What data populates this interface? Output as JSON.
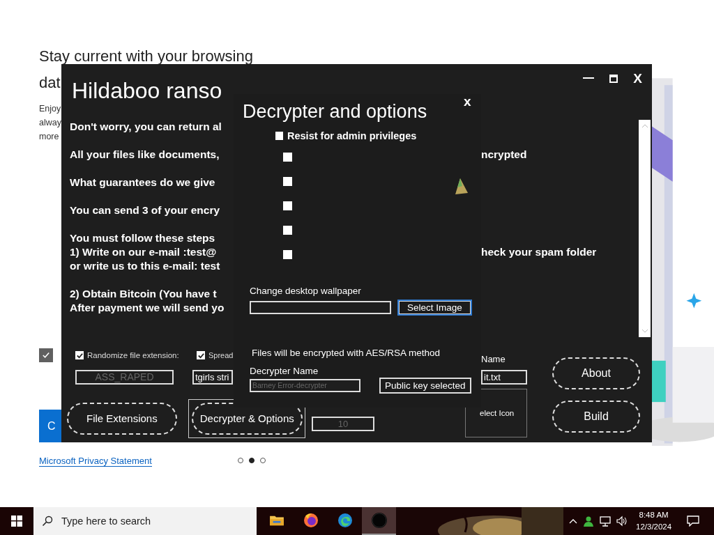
{
  "browser_page": {
    "heading_lines": [
      "Stay current with your browsing",
      "dat"
    ],
    "body_lines": [
      "Enjoy",
      "alway",
      "more"
    ],
    "checkbox": {
      "checked": true
    },
    "primary_button": {
      "label": "C"
    },
    "privacy_link": "Microsoft Privacy Statement",
    "carousel_dots": [
      {
        "selected": false
      },
      {
        "selected": true
      },
      {
        "selected": false
      }
    ]
  },
  "builder_window": {
    "title": "Hildaboo ranso",
    "close": "X",
    "message": [
      [
        {
          "text": "Don't worry, you can return al"
        }
      ],
      [
        {
          "text": "All your files like documents, ",
          "tail": "ncrypted"
        }
      ],
      [
        {
          "text": "What guarantees do we give "
        }
      ],
      [
        {
          "text": "You can send 3 of your encry"
        }
      ],
      [
        {
          "text": "You must follow these steps "
        },
        {
          "text": "1) Write on our e-mail :test@",
          "tail": "heck your spam folder"
        },
        {
          "text": "or write us to this e-mail: test"
        }
      ],
      [
        {
          "text": "2) Obtain Bitcoin (You have t"
        },
        {
          "text": "After payment we will send yo"
        }
      ]
    ],
    "options": [
      {
        "label": "Randomize file extension:",
        "checked": true
      },
      {
        "label": "Spread",
        "checked": true
      }
    ],
    "extension_field": {
      "value": "ASS_RAPED",
      "disabled": true
    },
    "spread_field": {
      "value": "tgirls stri",
      "disabled": false
    },
    "name_label": "Name",
    "name_field": {
      "value": "it.txt"
    },
    "icon_button": {
      "label": "elect Icon"
    },
    "count_field": {
      "value": "10",
      "disabled": true
    },
    "tab_buttons": [
      {
        "label": "File Extensions",
        "selected": false
      },
      {
        "label": "Decrypter & Options",
        "selected": true
      }
    ],
    "side_buttons": [
      {
        "label": "About"
      },
      {
        "label": "Build"
      }
    ]
  },
  "dialog": {
    "title": "Decrypter and options",
    "close": "x",
    "admin_option": {
      "label": "Resist for admin privileges",
      "checked": false
    },
    "sub_options": [
      {
        "checked": false
      },
      {
        "checked": false
      },
      {
        "checked": false
      },
      {
        "checked": false
      },
      {
        "checked": false
      }
    ],
    "wallpaper_label": "Change desktop wallpaper",
    "select_image_button": {
      "label": "Select Image",
      "focused": true
    },
    "encryption_note": "Files will be encrypted with AES/RSA method",
    "decrypter_name_label": "Decrypter Name",
    "decrypter_name_field": {
      "value": "Barney Error-decrypter",
      "disabled": true
    },
    "public_key_button": {
      "label": "Public key selected",
      "focused": false
    }
  },
  "taskbar": {
    "search_placeholder": "Type here to search",
    "apps": [
      {
        "kind": "folder",
        "selected": false
      },
      {
        "kind": "firefox",
        "selected": false
      },
      {
        "kind": "edge",
        "selected": false
      },
      {
        "kind": "disc",
        "selected": true
      }
    ],
    "time": "8:48 AM",
    "date": "12/3/2024"
  }
}
